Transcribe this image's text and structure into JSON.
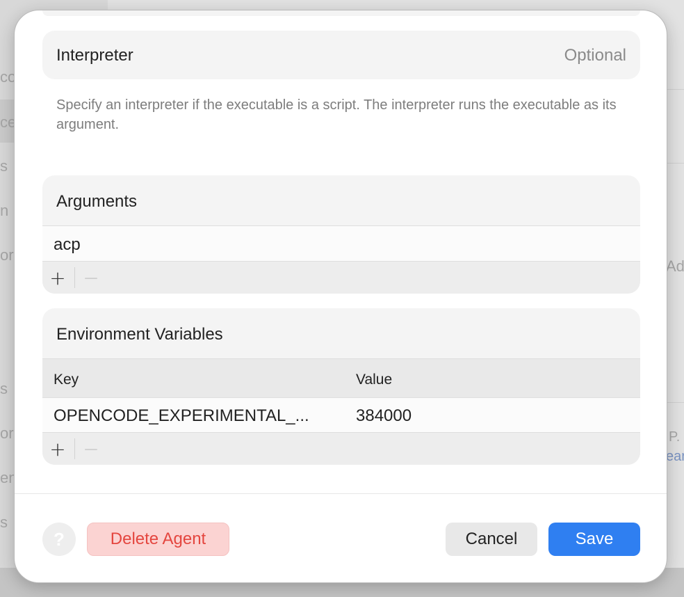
{
  "background": {
    "fragments": [
      "co",
      "ce",
      "s",
      "n",
      "or",
      "s",
      "or",
      "en",
      "s",
      "Ad",
      "P.",
      "ear"
    ]
  },
  "interpreter": {
    "label": "Interpreter",
    "placeholder": "Optional",
    "hint": "Specify an interpreter if the executable is a script. The interpreter runs the executable as its argument."
  },
  "arguments": {
    "title": "Arguments",
    "items": [
      "acp"
    ],
    "add_icon": "plus-icon",
    "remove_icon": "minus-icon"
  },
  "environment": {
    "title": "Environment Variables",
    "columns": [
      "Key",
      "Value"
    ],
    "rows": [
      {
        "key": "OPENCODE_EXPERIMENTAL_...",
        "value": "384000"
      }
    ],
    "add_icon": "plus-icon",
    "remove_icon": "minus-icon"
  },
  "footer": {
    "help_label": "?",
    "delete_label": "Delete Agent",
    "cancel_label": "Cancel",
    "save_label": "Save"
  },
  "colors": {
    "accent": "#2f7ff1",
    "destructive": "#e4463f",
    "destructive_bg": "#fbd3d2"
  }
}
